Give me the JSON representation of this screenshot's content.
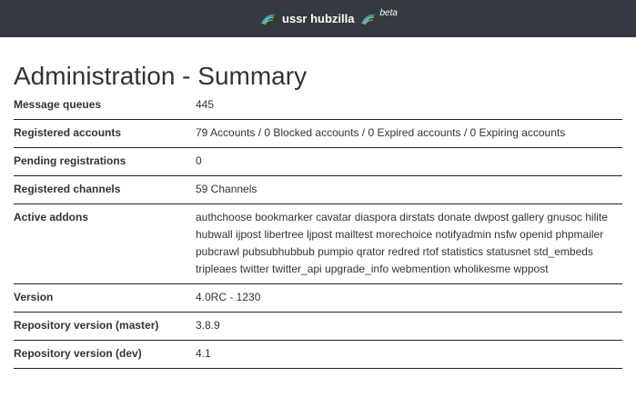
{
  "header": {
    "site_name": "ussr hubzilla",
    "badge": "beta",
    "logo_icon": "hubzilla-logo-icon",
    "bg_color": "#343a40"
  },
  "page": {
    "title": "Administration - Summary"
  },
  "summary": {
    "rows": [
      {
        "label": "Message queues",
        "value": "445"
      },
      {
        "label": "Registered accounts",
        "value": "79 Accounts / 0 Blocked accounts / 0 Expired accounts / 0 Expiring accounts"
      },
      {
        "label": "Pending registrations",
        "value": "0"
      },
      {
        "label": "Registered channels",
        "value": "59 Channels"
      },
      {
        "label": "Active addons",
        "value": "authchoose bookmarker cavatar diaspora dirstats donate dwpost gallery gnusoc hilite hubwall ijpost libertree ljpost mailtest morechoice notifyadmin nsfw openid phpmailer pubcrawl pubsubhubbub pumpio qrator redred rtof statistics statusnet std_embeds tripleaes twitter twitter_api upgrade_info webmention wholikesme wppost"
      },
      {
        "label": "Version",
        "value": "4.0RC - 1230"
      },
      {
        "label": "Repository version (master)",
        "value": "3.8.9"
      },
      {
        "label": "Repository version (dev)",
        "value": "4.1"
      }
    ]
  }
}
